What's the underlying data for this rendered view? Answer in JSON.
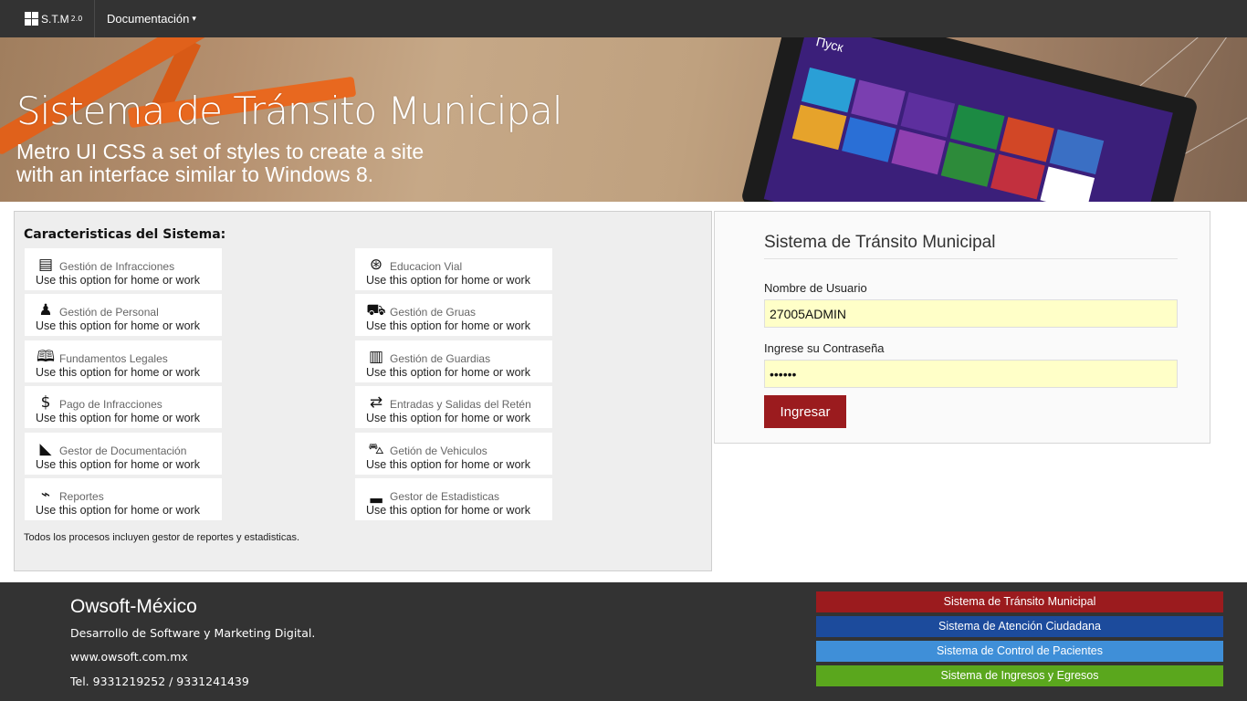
{
  "nav": {
    "brand": "S.T.M",
    "version": "2.0",
    "menu_label": "Documentación",
    "menu_chevron": "▾"
  },
  "banner": {
    "title": "Sistema de Tránsito Municipal",
    "subtitle_line1": "Metro UI CSS a set of styles to create a site",
    "subtitle_line2": "with an interface similar to Windows 8.",
    "tablet_text": "Пуск"
  },
  "features": {
    "heading": "Caracteristicas del Sistema:",
    "left": [
      {
        "icon": "newspaper-icon",
        "glyph": "▤",
        "title": "Gestión de Infracciones",
        "desc": "Use this option for home or work"
      },
      {
        "icon": "user-icon",
        "glyph": "♟",
        "title": "Gestión de Personal",
        "desc": "Use this option for home or work"
      },
      {
        "icon": "book-icon",
        "glyph": "🕮",
        "title": "Fundamentos Legales",
        "desc": "Use this option for home or work"
      },
      {
        "icon": "money-icon",
        "glyph": "$",
        "title": "Pago de Infracciones",
        "desc": "Use this option for home or work"
      },
      {
        "icon": "document-icon",
        "glyph": "◣",
        "title": "Gestor de Documentación",
        "desc": "Use this option for home or work"
      },
      {
        "icon": "presentation-icon",
        "glyph": "⌁",
        "title": "Reportes",
        "desc": "Use this option for home or work"
      }
    ],
    "right": [
      {
        "icon": "steering-wheel-icon",
        "glyph": "⊛",
        "title": "Educacion Vial",
        "desc": "Use this option for home or work"
      },
      {
        "icon": "bus-icon",
        "glyph": "⛟",
        "title": "Gestión de Gruas",
        "desc": "Use this option for home or work"
      },
      {
        "icon": "clipboard-icon",
        "glyph": "▥",
        "title": "Gestión de Guardias",
        "desc": "Use this option for home or work"
      },
      {
        "icon": "transfer-icon",
        "glyph": "⇄",
        "title": "Entradas y Salidas del Retén",
        "desc": "Use this option for home or work"
      },
      {
        "icon": "car-icon",
        "glyph": "⛍",
        "title": "Getión de Vehiculos",
        "desc": "Use this option for home or work"
      },
      {
        "icon": "bar-chart-icon",
        "glyph": "▂",
        "title": "Gestor de Estadisticas",
        "desc": "Use this option for home or work"
      }
    ],
    "note": "Todos los procesos incluyen gestor de reportes y estadisticas."
  },
  "login": {
    "title": "Sistema de Tránsito Municipal",
    "username_label": "Nombre de Usuario",
    "username_value": "27005ADMIN",
    "password_label": "Ingrese su Contraseña",
    "password_value": "••••••",
    "submit_label": "Ingresar"
  },
  "footer": {
    "company": "Owsoft-México",
    "tagline": "Desarrollo de Software y Marketing Digital.",
    "website": "www.owsoft.com.mx",
    "phone": "Tel. 9331219252 / 9331241439",
    "systems": [
      {
        "label": "Sistema de Tránsito Municipal",
        "color": "#9b1b1e"
      },
      {
        "label": "Sistema de Atención Ciudadana",
        "color": "#1c4b9c"
      },
      {
        "label": "Sistema de Control de Pacientes",
        "color": "#3f8fd8"
      },
      {
        "label": "Sistema de Ingresos y Egresos",
        "color": "#5aa71d"
      }
    ]
  },
  "colors": {
    "nav_bg": "#333333",
    "accent": "#9b1b1e",
    "input_bg": "#ffffc8"
  }
}
